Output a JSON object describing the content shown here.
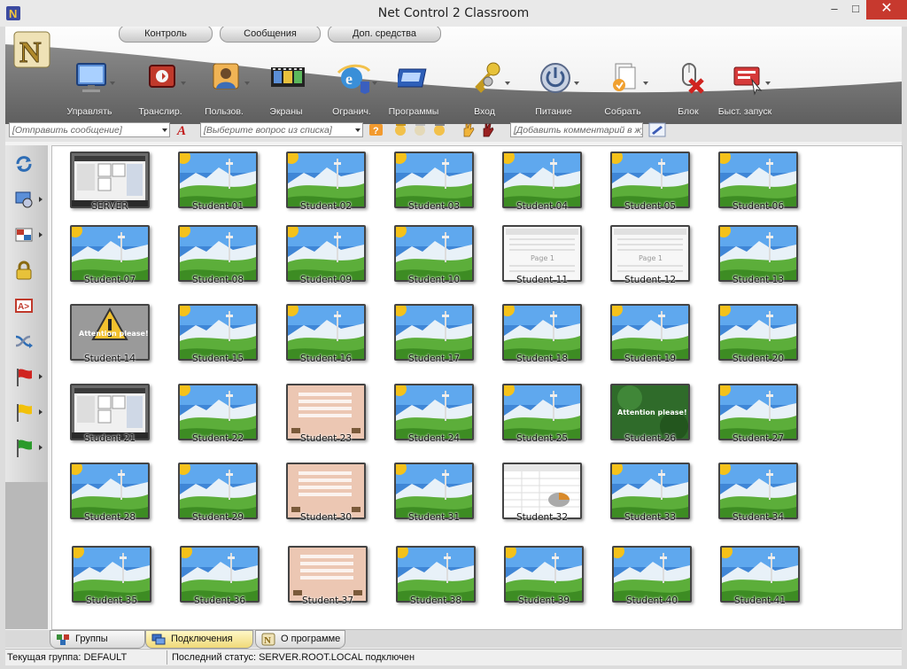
{
  "window": {
    "title": "Net Control 2 Classroom",
    "min": "–",
    "max": "□",
    "close": "✕"
  },
  "menu_tabs": [
    {
      "label": "Контроль",
      "active": true
    },
    {
      "label": "Сообщения",
      "active": false
    },
    {
      "label": "Доп. средства",
      "active": false
    }
  ],
  "toolbar": [
    {
      "label": "Управлять",
      "icon": "monitor-icon",
      "dropdown": true
    },
    {
      "label": "Транслир.",
      "icon": "broadcast-icon",
      "dropdown": true
    },
    {
      "label": "Пользов.",
      "icon": "user-icon",
      "dropdown": true
    },
    {
      "label": "Экраны",
      "icon": "screens-filmstrip-icon",
      "dropdown": false
    },
    {
      "label": "Огранич.",
      "icon": "ie-restrict-icon",
      "dropdown": true
    },
    {
      "label": "Программы",
      "icon": "programs-icon",
      "dropdown": false
    },
    {
      "label": "Вход",
      "icon": "keys-icon",
      "dropdown": true
    },
    {
      "label": "Питание",
      "icon": "power-icon",
      "dropdown": true
    },
    {
      "label": "Собрать",
      "icon": "collect-files-icon",
      "dropdown": true
    },
    {
      "label": "Блок",
      "icon": "block-mouse-icon",
      "dropdown": false
    },
    {
      "label": "Быст. запуск",
      "icon": "quick-launch-icon",
      "dropdown": true
    }
  ],
  "input_row": {
    "message_placeholder": "[Отправить сообщение]",
    "question_placeholder": "[Выберите вопрос из списка]",
    "comment_placeholder": "[Добавить комментарий в жур"
  },
  "students": [
    {
      "name": "SERVER",
      "screen": "desktop"
    },
    {
      "name": "Student 01",
      "screen": "landscape"
    },
    {
      "name": "Student 02",
      "screen": "landscape"
    },
    {
      "name": "Student 03",
      "screen": "landscape"
    },
    {
      "name": "Student 04",
      "screen": "landscape"
    },
    {
      "name": "Student 05",
      "screen": "landscape"
    },
    {
      "name": "Student 06",
      "screen": "landscape"
    },
    {
      "name": "Student 07",
      "screen": "landscape"
    },
    {
      "name": "Student 08",
      "screen": "landscape"
    },
    {
      "name": "Student 09",
      "screen": "landscape"
    },
    {
      "name": "Student 10",
      "screen": "landscape"
    },
    {
      "name": "Student 11",
      "screen": "document"
    },
    {
      "name": "Student 12",
      "screen": "document"
    },
    {
      "name": "Student 13",
      "screen": "landscape"
    },
    {
      "name": "Student 14",
      "screen": "attention-gray"
    },
    {
      "name": "Student 15",
      "screen": "landscape"
    },
    {
      "name": "Student 16",
      "screen": "landscape"
    },
    {
      "name": "Student 17",
      "screen": "landscape"
    },
    {
      "name": "Student 18",
      "screen": "landscape"
    },
    {
      "name": "Student 19",
      "screen": "landscape"
    },
    {
      "name": "Student 20",
      "screen": "landscape"
    },
    {
      "name": "Student 21",
      "screen": "desktop"
    },
    {
      "name": "Student 22",
      "screen": "landscape"
    },
    {
      "name": "Student 23",
      "screen": "quiz"
    },
    {
      "name": "Student 24",
      "screen": "landscape"
    },
    {
      "name": "Student 25",
      "screen": "landscape"
    },
    {
      "name": "Student 26",
      "screen": "attention-green"
    },
    {
      "name": "Student 27",
      "screen": "landscape"
    },
    {
      "name": "Student 28",
      "screen": "landscape"
    },
    {
      "name": "Student 29",
      "screen": "landscape"
    },
    {
      "name": "Student 30",
      "screen": "quiz"
    },
    {
      "name": "Student 31",
      "screen": "landscape"
    },
    {
      "name": "Student 32",
      "screen": "spreadsheet"
    },
    {
      "name": "Student 33",
      "screen": "landscape"
    },
    {
      "name": "Student 34",
      "screen": "landscape"
    },
    {
      "name": "Student 35",
      "screen": "landscape"
    },
    {
      "name": "Student 36",
      "screen": "landscape"
    },
    {
      "name": "Student 37",
      "screen": "quiz"
    },
    {
      "name": "Student 38",
      "screen": "landscape"
    },
    {
      "name": "Student 39",
      "screen": "landscape"
    },
    {
      "name": "Student 40",
      "screen": "landscape"
    },
    {
      "name": "Student 41",
      "screen": "landscape"
    }
  ],
  "screen_texts": {
    "attention": "Attention please!",
    "page": "Page 1"
  },
  "bottom_tabs": [
    {
      "label": "Группы",
      "icon": "groups-icon",
      "active": false
    },
    {
      "label": "Подключения",
      "icon": "connections-icon",
      "active": true
    },
    {
      "label": "О программе",
      "icon": "about-icon",
      "active": false
    }
  ],
  "status": {
    "group": "Текущая группа: DEFAULT",
    "last": "Последний статус: SERVER.ROOT.LOCAL подключен"
  },
  "sidebar_icons": [
    "refresh-icon",
    "monitor-options-icon",
    "layout-icon",
    "lock-icon",
    "text-message-icon",
    "shuffle-icon",
    "red-flag-icon",
    "yellow-flag-icon",
    "green-flag-icon"
  ]
}
